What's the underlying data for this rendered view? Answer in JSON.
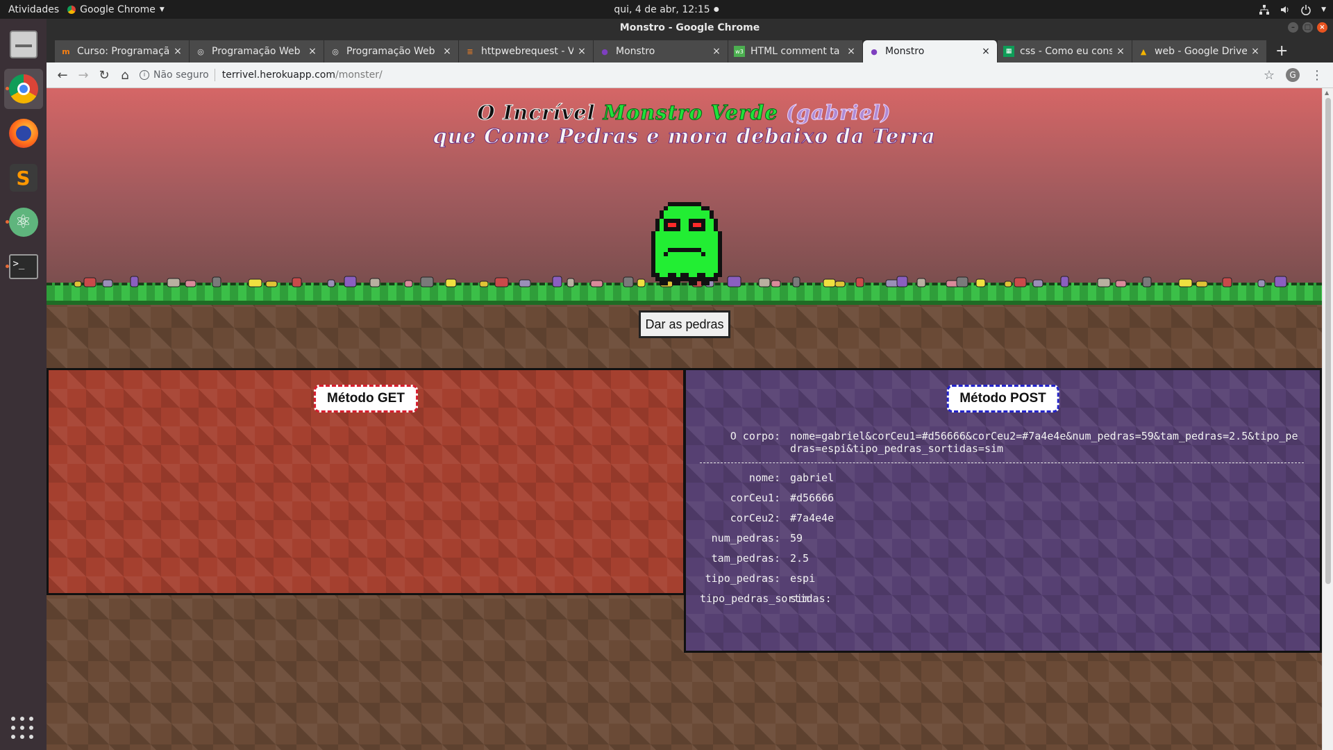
{
  "system": {
    "activities": "Atividades",
    "app_menu": "Google Chrome",
    "clock": "qui, 4 de abr, 12:15"
  },
  "window": {
    "title": "Monstro - Google Chrome"
  },
  "tabs": [
    {
      "label": "Curso: Programaçã",
      "icon": "moodle-icon"
    },
    {
      "label": "Programação Web",
      "icon": "globe-icon"
    },
    {
      "label": "Programação Web",
      "icon": "globe-icon"
    },
    {
      "label": "httpwebrequest - V",
      "icon": "stackoverflow-icon"
    },
    {
      "label": "Monstro",
      "icon": "monster-icon"
    },
    {
      "label": "HTML comment ta",
      "icon": "w3-icon"
    },
    {
      "label": "Monstro",
      "icon": "monster-icon",
      "active": true
    },
    {
      "label": "css - Como eu cons",
      "icon": "stackoverflow-icon"
    },
    {
      "label": "web - Google Drive",
      "icon": "drive-icon"
    }
  ],
  "address": {
    "security_label": "Não seguro",
    "host": "terrivel.herokuapp.com",
    "path": "/monster/"
  },
  "page": {
    "title_line1_part1": "O Incrível",
    "title_line1_part2": "Monstro Verde",
    "title_line1_part3": "(gabriel)",
    "title_line2": "que Come Pedras e mora debaixo da Terra",
    "give_button": "Dar as pedras",
    "get_panel": {
      "title": "Método GET"
    },
    "post_panel": {
      "title": "Método POST",
      "body_label": "O corpo:",
      "body_value": "nome=gabriel&corCeu1=#d56666&corCeu2=#7a4e4e&num_pedras=59&tam_pedras=2.5&tipo_pedras=espi&tipo_pedras_sortidas=sim",
      "fields": [
        {
          "key": "nome:",
          "value": "gabriel"
        },
        {
          "key": "corCeu1:",
          "value": "#d56666"
        },
        {
          "key": "corCeu2:",
          "value": "#7a4e4e"
        },
        {
          "key": "num_pedras:",
          "value": "59"
        },
        {
          "key": "tam_pedras:",
          "value": "2.5"
        },
        {
          "key": "tipo_pedras:",
          "value": "espi"
        },
        {
          "key": "tipo_pedras_sortidas:",
          "value": "sim"
        }
      ]
    }
  },
  "colors": {
    "sky_top": "#d56666",
    "sky_bottom": "#7a4e4e",
    "monster": "#22ee33"
  }
}
